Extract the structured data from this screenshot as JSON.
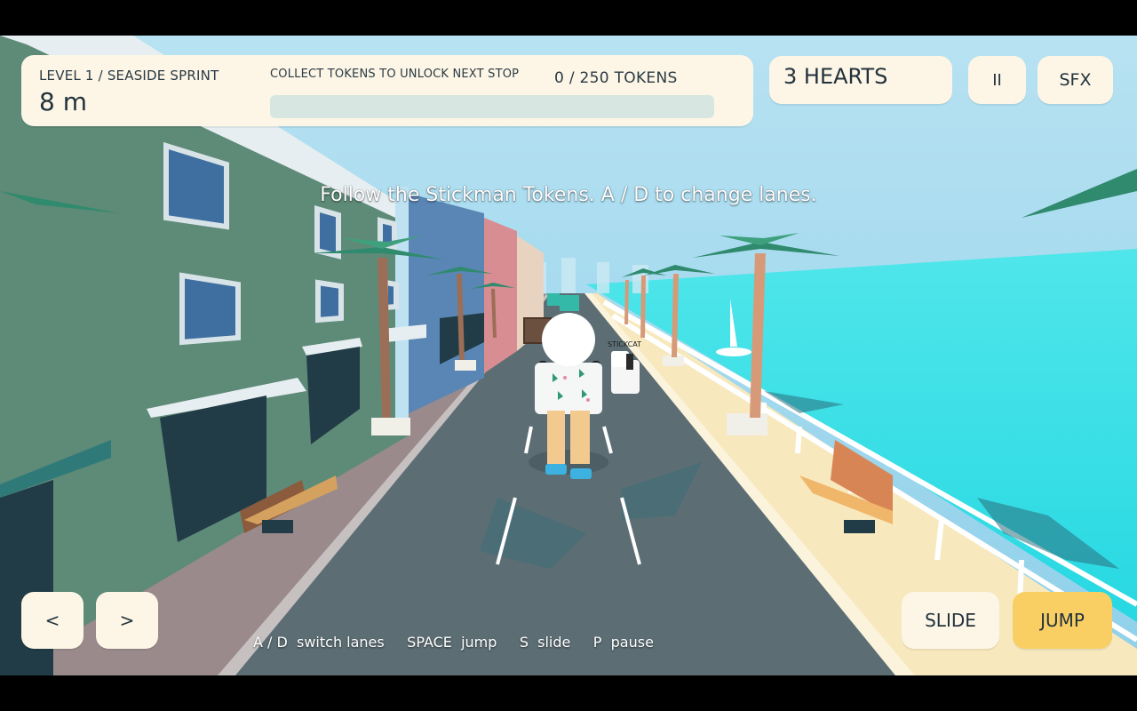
{
  "hud": {
    "level_label": "LEVEL 1 / SEASIDE SPRINT",
    "distance": "8 m",
    "goal_text": "COLLECT TOKENS TO UNLOCK NEXT STOP",
    "token_count": "0 / 250 TOKENS",
    "token_progress": 0,
    "hearts": "3 HEARTS",
    "pause_label": "II",
    "sfx_label": "SFX"
  },
  "hint": "Follow the Stickman Tokens. A / D to change lanes.",
  "controls": {
    "left_label": "<",
    "right_label": ">",
    "slide_label": "SLIDE",
    "jump_label": "JUMP",
    "key_hints": "A / D  switch lanes     SPACE  jump     S  slide     P  pause"
  },
  "scene": {
    "npc_name": "STICKCAT",
    "colors": {
      "sky": "#a9dcef",
      "sea": "#35e2e6",
      "road": "#5c6e74",
      "sidewalk": "#f7e8bd",
      "building": "#5e8a78",
      "panel": "#fdf6e6",
      "jump_button": "#f9cf63"
    }
  }
}
